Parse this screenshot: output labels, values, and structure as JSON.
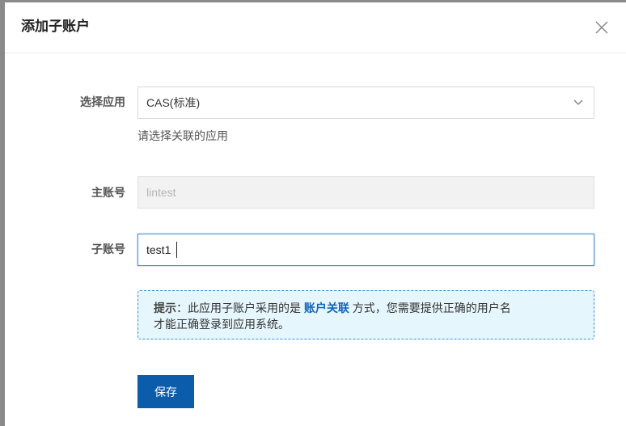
{
  "dialog": {
    "title": "添加子账户",
    "close_icon": "close-icon"
  },
  "form": {
    "app": {
      "label": "选择应用",
      "value": "CAS(标准)",
      "help": "请选择关联的应用",
      "icon": "chevron-down-icon"
    },
    "main_account": {
      "label": "主账号",
      "value": "lintest"
    },
    "sub_account": {
      "label": "子账号",
      "value": "test1"
    }
  },
  "tip": {
    "prefix": "提示",
    "text_before": "：此应用子账户采用的是 ",
    "link": "账户关联",
    "text_after": " 方式，您需要提供正确的用户名",
    "line2": "才能正确登录到应用系统。"
  },
  "actions": {
    "save_label": "保存"
  },
  "colors": {
    "primary": "#0b5cab",
    "tip_background": "#e6f6fd",
    "tip_border": "#3b8fd8",
    "focus_border": "#4a90d9"
  }
}
